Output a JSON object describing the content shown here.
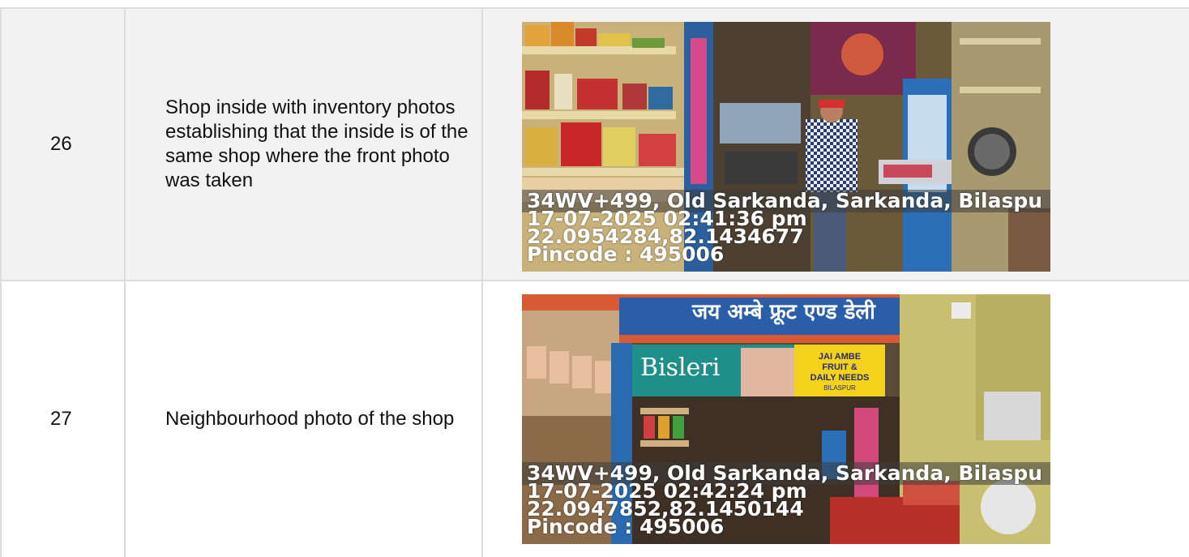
{
  "rows": [
    {
      "number": "26",
      "description": "Shop inside with inventory photos establishing that the inside is of the same shop where the front photo was taken",
      "photo_stamp": {
        "address": "34WV+499, Old Sarkanda, Sarkanda, Bilaspu",
        "datetime": "17-07-2025 02:41:36 pm",
        "coords": "22.0954284,82.1434677",
        "pincode": "Pincode : 495006"
      }
    },
    {
      "number": "27",
      "description": "Neighbourhood photo of the shop",
      "photo_stamp": {
        "address": "34WV+499, Old Sarkanda, Sarkanda, Bilaspu",
        "datetime": "17-07-2025 02:42:24 pm",
        "coords": "22.0947852,82.1450144",
        "pincode": "Pincode : 495006"
      },
      "signage": {
        "hindi_banner": "जय अम्बे फ्रूट एण्ड डेली",
        "bisleri": "Bisleri",
        "shop_board_line1": "JAI AMBE",
        "shop_board_line2": "FRUIT &",
        "shop_board_line3": "DAILY NEEDS",
        "shop_board_line4": "BILASPUR"
      }
    }
  ]
}
